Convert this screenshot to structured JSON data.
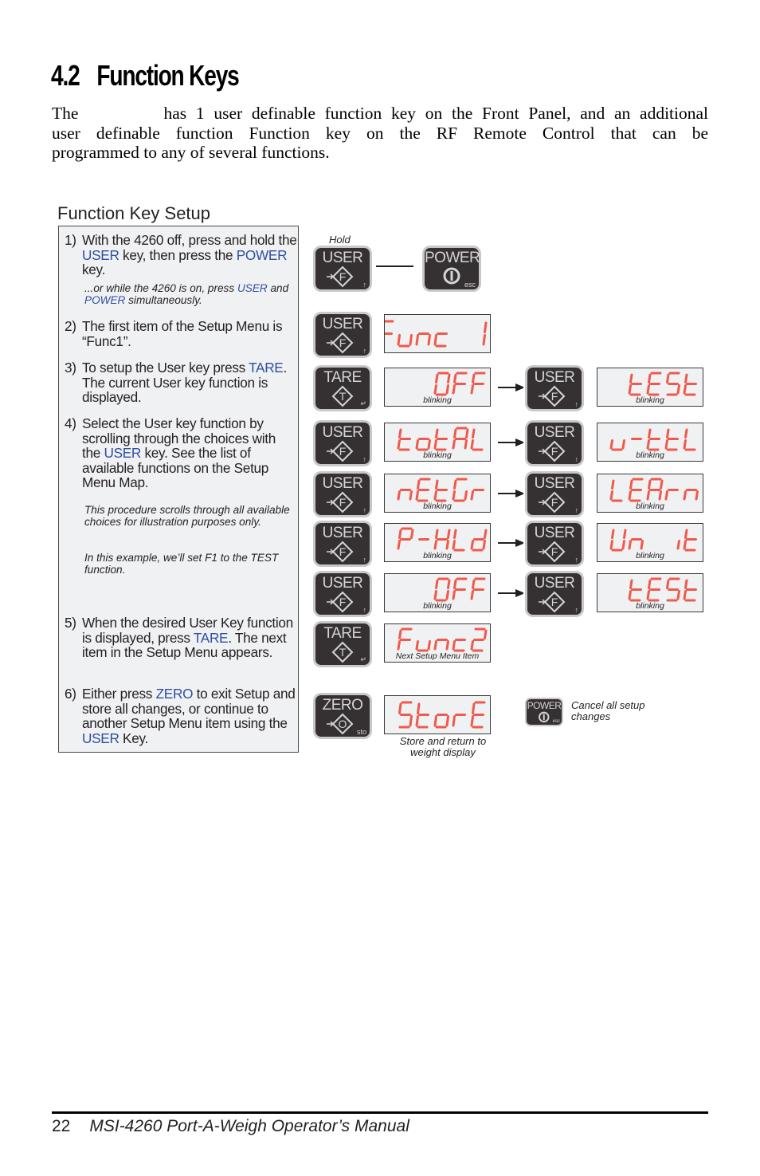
{
  "heading": {
    "number": "4.2",
    "title": "Function Keys"
  },
  "intro": {
    "lines": [
      {
        "pre": "The",
        "post": "has 1 user definable function key on the Front Panel, and an additional"
      },
      {
        "text": "user definable function Function key on the RF Remote Control that can be"
      },
      {
        "text": "programmed to any of several functions."
      }
    ]
  },
  "section_title": "Function Key Setup",
  "steps": [
    {
      "num": "1)",
      "parts": [
        [
          "With the 4260 off, press and hold the ",
          ""
        ],
        [
          "USER",
          "blue"
        ],
        [
          " key, then press the ",
          ""
        ],
        [
          "POWER",
          "blue"
        ],
        [
          " key.",
          ""
        ]
      ]
    },
    {
      "num": "2)",
      "parts": [
        [
          "The first item of the Setup Menu is “Func1”.",
          ""
        ]
      ]
    },
    {
      "num": "3)",
      "parts": [
        [
          "To setup the User key press ",
          ""
        ],
        [
          "TARE",
          "blue"
        ],
        [
          ". The current User key function is displayed.",
          ""
        ]
      ]
    },
    {
      "num": "4)",
      "parts": [
        [
          "Select the User key function by scrolling through the choices with the ",
          ""
        ],
        [
          "USER",
          "blue"
        ],
        [
          " key. See the list of available functions on the Setup Menu Map.",
          ""
        ]
      ]
    },
    {
      "num": "5)",
      "parts": [
        [
          "When the desired User Key function is displayed, press ",
          ""
        ],
        [
          "TARE",
          "blue"
        ],
        [
          ". The next item in the Setup Menu appears.",
          ""
        ]
      ]
    },
    {
      "num": "6)",
      "parts": [
        [
          "Either press ",
          ""
        ],
        [
          "ZERO",
          "blue"
        ],
        [
          " to exit Setup and store all changes, or continue to another Setup Menu item using the ",
          ""
        ],
        [
          "USER",
          "blue"
        ],
        [
          " Key.",
          ""
        ]
      ]
    }
  ],
  "notes": [
    {
      "parts": [
        [
          "...or while the 4260 is on, press ",
          ""
        ],
        [
          "USER",
          "blue"
        ],
        [
          " and ",
          ""
        ],
        [
          "POWER",
          "blue"
        ],
        [
          " simultaneously.",
          ""
        ]
      ]
    },
    {
      "parts": [
        [
          "This procedure scrolls through all available choices for illustration purposes only.",
          ""
        ]
      ]
    },
    {
      "parts": [
        [
          "In this example, we’ll set F1 to the TEST function.",
          ""
        ]
      ]
    }
  ],
  "diagram": {
    "hold_label": "Hold",
    "keys": {
      "user": {
        "label": "USER",
        "glyph": "F",
        "sub": "↑",
        "icon": "user-function-icon"
      },
      "tare": {
        "label": "TARE",
        "glyph": "T",
        "sub": "↵",
        "icon": "tare-icon"
      },
      "zero": {
        "label": "ZERO",
        "glyph": "O",
        "sub": "sto",
        "icon": "zero-icon"
      },
      "power": {
        "label": "POWER",
        "glyph": "power",
        "sub": "esc",
        "icon": "power-icon"
      }
    },
    "rows": [
      {
        "key": "user",
        "display": "Func 1",
        "caption": ""
      },
      {
        "key": "tare",
        "display": "  OFF",
        "caption": "blinking",
        "next_key": "user",
        "next_display": " tESt",
        "next_caption": "blinking"
      },
      {
        "key": "user",
        "display": "totAL",
        "caption": "blinking",
        "next_key": "user",
        "next_display": "u-ttL",
        "next_caption": "blinking"
      },
      {
        "key": "user",
        "display": "nEtGr",
        "caption": "blinking",
        "next_key": "user",
        "next_display": "LEArn",
        "next_caption": "blinking"
      },
      {
        "key": "user",
        "display": "P-HLd",
        "caption": "blinking",
        "next_key": "user",
        "next_display": " Un it",
        "next_caption": "blinking"
      },
      {
        "key": "user",
        "display": "  OFF",
        "caption": "blinking",
        "next_key": "user",
        "next_display": " tESt",
        "next_caption": "blinking"
      },
      {
        "key": "tare",
        "display": "Func2",
        "caption": "Next Setup Menu Item"
      },
      {
        "key": "zero",
        "display": "StorE",
        "caption": ""
      }
    ],
    "store_caption": "Store and return to weight display",
    "cancel_caption": "Cancel all setup changes",
    "segment_color": "#ef5a4c"
  },
  "footer": {
    "page": "22",
    "title": "MSI-4260 Port-A-Weigh Operator’s Manual"
  }
}
